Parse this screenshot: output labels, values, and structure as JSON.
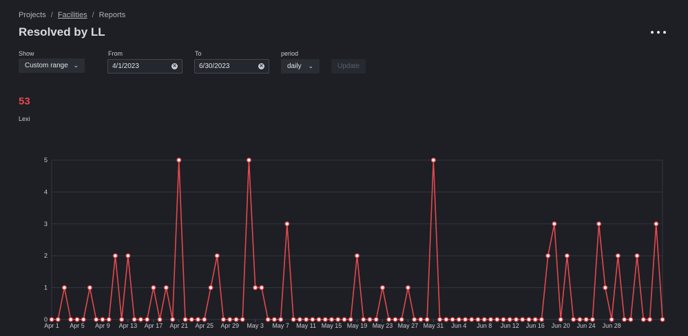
{
  "breadcrumb": {
    "projects": "Projects",
    "facilities": "Facilities",
    "reports": "Reports",
    "separator": "/"
  },
  "page": {
    "title": "Resolved by LL"
  },
  "filters": {
    "show_label": "Show",
    "show_value": "Custom range",
    "from_label": "From",
    "from_value": "4/1/2023",
    "to_label": "To",
    "to_value": "6/30/2023",
    "period_label": "period",
    "period_value": "daily",
    "update_label": "Update"
  },
  "summary": {
    "total": "53",
    "name": "Lexi"
  },
  "colors": {
    "accent": "#e5484d",
    "background": "#1d1f24"
  },
  "chart_data": {
    "type": "line",
    "ylim": [
      0,
      5
    ],
    "yticks": [
      "0",
      "1",
      "2",
      "3",
      "4",
      "5"
    ],
    "xtick_labels": [
      "Apr 1",
      "Apr 5",
      "Apr 9",
      "Apr 13",
      "Apr 17",
      "Apr 21",
      "Apr 25",
      "Apr 29",
      "May 3",
      "May 7",
      "May 11",
      "May 15",
      "May 19",
      "May 23",
      "May 27",
      "May 31",
      "Jun 4",
      "Jun 8",
      "Jun 12",
      "Jun 16",
      "Jun 20",
      "Jun 24",
      "Jun 28"
    ],
    "xtick_every": 4,
    "grid": true,
    "series": [
      {
        "values": [
          0,
          0,
          1,
          0,
          0,
          0,
          1,
          0,
          0,
          0,
          2,
          0,
          2,
          0,
          0,
          0,
          1,
          0,
          1,
          0,
          5,
          0,
          0,
          0,
          0,
          1,
          2,
          0,
          0,
          0,
          0,
          5,
          1,
          1,
          0,
          0,
          0,
          3,
          0,
          0,
          0,
          0,
          0,
          0,
          0,
          0,
          0,
          0,
          2,
          0,
          0,
          0,
          1,
          0,
          0,
          0,
          1,
          0,
          0,
          0,
          5,
          0,
          0,
          0,
          0,
          0,
          0,
          0,
          0,
          0,
          0,
          0,
          0,
          0,
          0,
          0,
          0,
          0,
          2,
          3,
          0,
          2,
          0,
          0,
          0,
          0,
          3,
          1,
          0,
          2,
          0,
          0,
          2,
          0,
          0,
          3,
          0
        ]
      }
    ]
  }
}
